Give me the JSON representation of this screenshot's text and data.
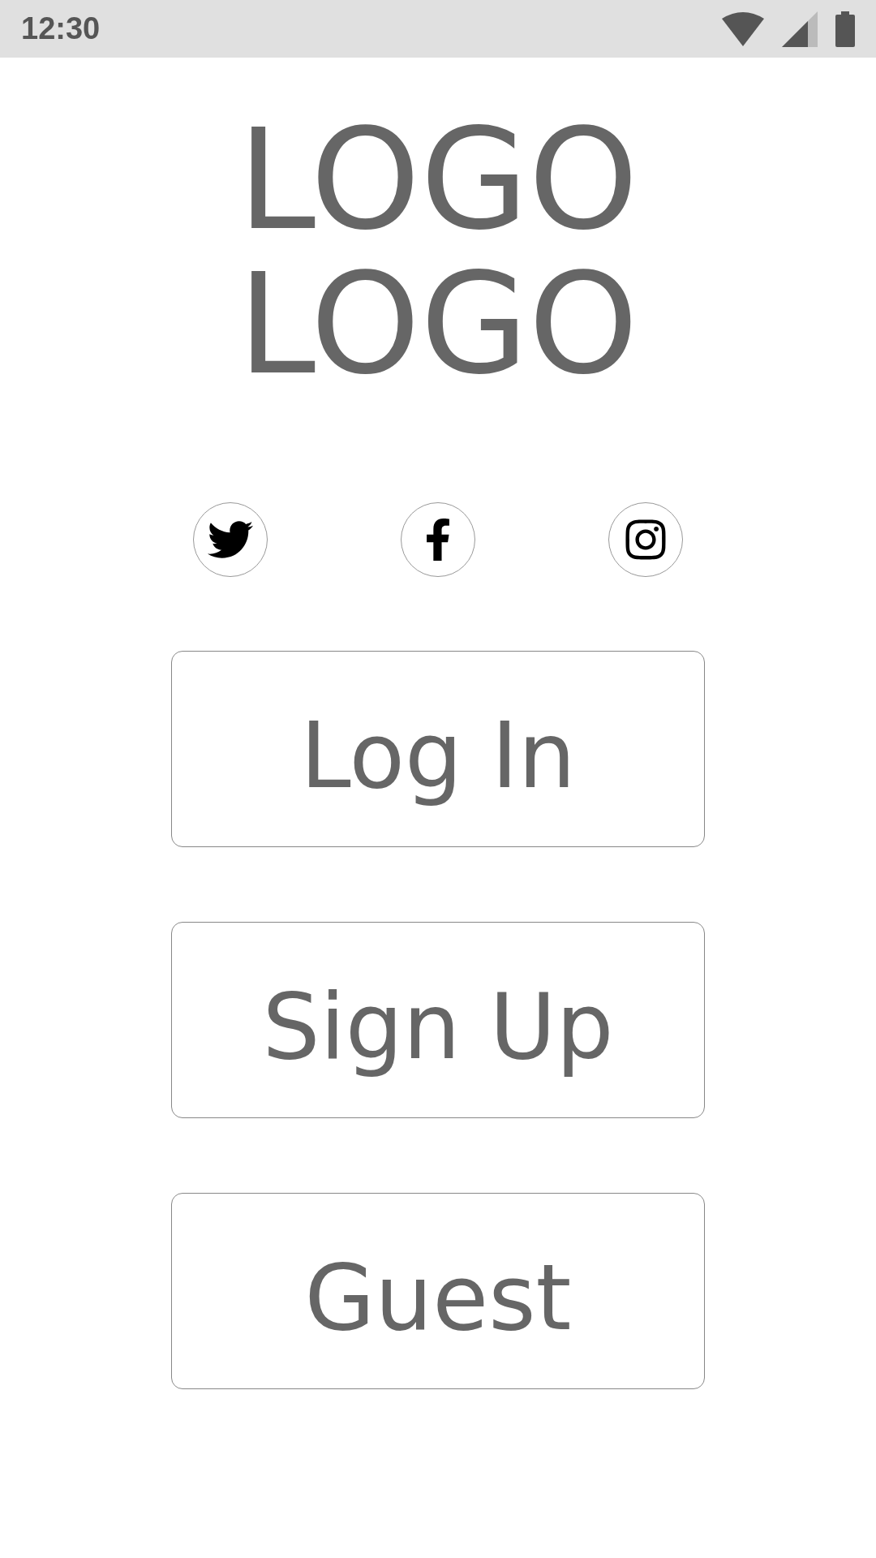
{
  "status_bar": {
    "time": "12:30"
  },
  "logo": [
    "LOGO",
    "LOGO"
  ],
  "social": [
    {
      "kind": "twitter"
    },
    {
      "kind": "facebook"
    },
    {
      "kind": "instagram"
    }
  ],
  "buttons": [
    "Log In",
    "Sign Up",
    "Guest"
  ]
}
